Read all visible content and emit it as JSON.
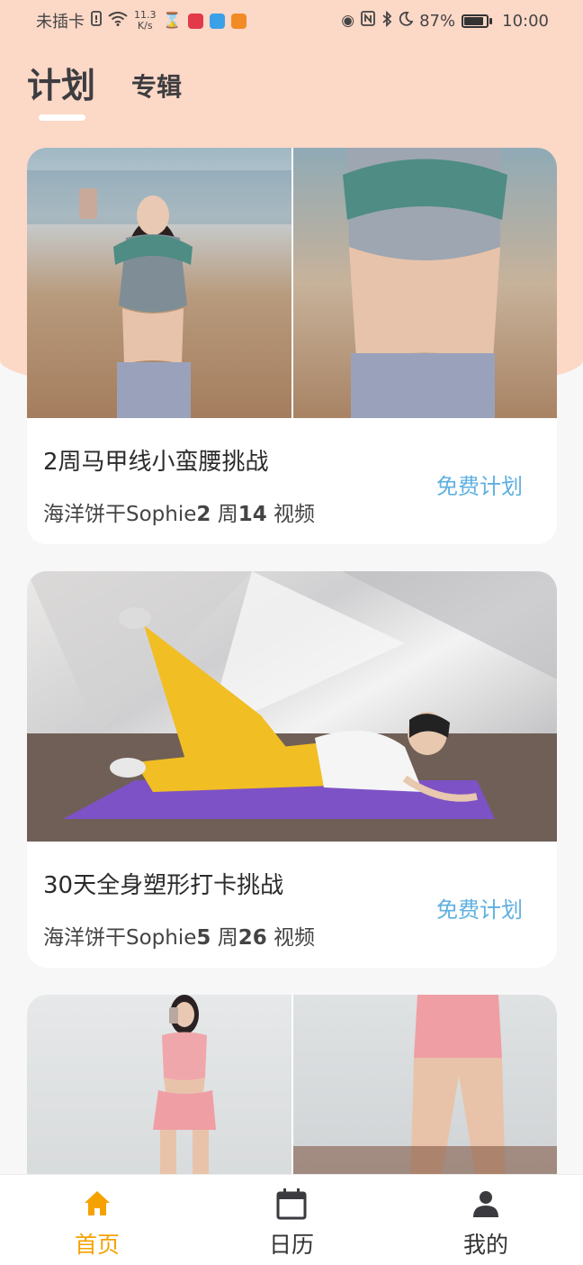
{
  "status_bar": {
    "carrier": "未插卡",
    "net_speed_value": "11.3",
    "net_speed_unit": "K/s",
    "battery_percent": "87%",
    "battery_level": 0.87,
    "time": "10:00"
  },
  "top_tabs": [
    {
      "label": "计划",
      "active": true
    },
    {
      "label": "专辑",
      "active": false
    }
  ],
  "plans": [
    {
      "title": "2周马甲线小蛮腰挑战",
      "author": "海洋饼干Sophie",
      "weeks": "2",
      "weeks_unit": " 周",
      "videos": "14",
      "videos_unit": " 视频",
      "badge": "免费计划"
    },
    {
      "title": "30天全身塑形打卡挑战",
      "author": "海洋饼干Sophie",
      "weeks": "5",
      "weeks_unit": " 周",
      "videos": "26",
      "videos_unit": " 视频",
      "badge": "免费计划"
    }
  ],
  "bottom_nav": [
    {
      "label": "首页",
      "icon": "home-icon",
      "active": true
    },
    {
      "label": "日历",
      "icon": "calendar-icon",
      "active": false
    },
    {
      "label": "我的",
      "icon": "user-icon",
      "active": false
    }
  ],
  "colors": {
    "accent": "#f5a200",
    "badge": "#5fb0e0",
    "header_bg": "#fcd8c7"
  }
}
